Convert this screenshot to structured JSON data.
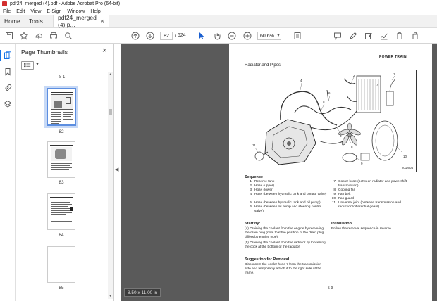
{
  "window": {
    "title": "pdf24_merged (4).pdf - Adobe Acrobat Pro (64-bit)"
  },
  "menu": [
    "File",
    "Edit",
    "View",
    "E-Sign",
    "Window",
    "Help"
  ],
  "tabs": {
    "home": "Home",
    "tools": "Tools",
    "document": "pdf24_merged (4).p..."
  },
  "toolbar": {
    "current_page": "82",
    "page_separator": "/",
    "total_pages": "624",
    "zoom": "60.6%"
  },
  "panel": {
    "title": "Page Thumbnails",
    "top_label": "8 1",
    "thumbnails": [
      {
        "label": "82",
        "selected": true
      },
      {
        "label": "83",
        "selected": false
      },
      {
        "label": "84",
        "selected": false
      },
      {
        "label": "85",
        "selected": false
      }
    ]
  },
  "page_size_badge": "8.50 x 11.00 in",
  "document": {
    "section_header": "POWER TRAIN",
    "title": "Radiator and Pipes",
    "figure_code": "201M04",
    "sequence_title": "Sequence",
    "sequence_left": [
      {
        "n": "1",
        "text": "Reserve tank"
      },
      {
        "n": "2",
        "text": "Hose (upper)"
      },
      {
        "n": "3",
        "text": "Hose (lower)"
      },
      {
        "n": "4",
        "text": "Hose (between hydraulic tank and control valve)"
      },
      {
        "n": "5",
        "text": "Hose (between hydraulic tank and oil pump)"
      },
      {
        "n": "6",
        "text": "Hose (between oil pump and steering control valve)"
      }
    ],
    "sequence_right": [
      {
        "n": "7",
        "text": "Cooler hose (between radiator and powershift transmission)"
      },
      {
        "n": "8",
        "text": "Cooling fan"
      },
      {
        "n": "9",
        "text": "Fan belt"
      },
      {
        "n": "10",
        "text": "Fan guard"
      },
      {
        "n": "11",
        "text": "Universal joint (between transmission and reduction/differential gears)"
      }
    ],
    "start_by_title": "Start by:",
    "start_by_a": "(a)  Draining the coolant from the engine by removing the drain plug (note that the position of the drain plug differs by engine type).",
    "start_by_b": "(b)  Draining the coolant from the radiator by loosening the cock at the bottom of the radiator.",
    "suggestion_title": "Suggestion for Removal",
    "suggestion_text": "Disconnect the cooler hose 7 from the transmission side and temporarily attach it to the right side of the frame.",
    "installation_title": "Installation",
    "installation_text": "Follow the removal sequence in reverse.",
    "page_number": "5-9"
  }
}
